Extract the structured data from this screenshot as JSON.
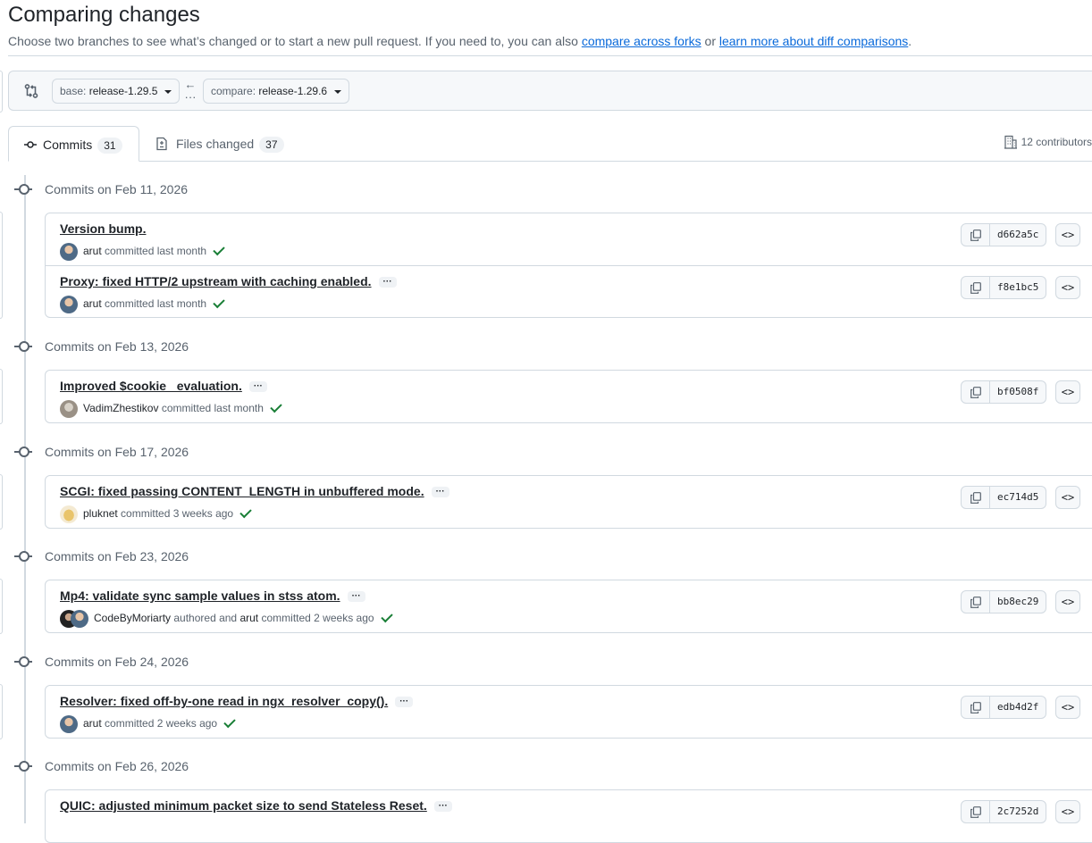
{
  "page": {
    "title": "Comparing changes",
    "subtitle_prefix": "Choose two branches to see what’s changed or to start a new pull request. If you need to, you can also ",
    "link_forks": "compare across forks",
    "subtitle_mid": " or ",
    "link_learn": "learn more about diff comparisons",
    "subtitle_suffix": "."
  },
  "range": {
    "base_key": "base:",
    "base_value": "release-1.29.5",
    "arrow_icon": "arrow-left-icon",
    "compare_key": "compare:",
    "compare_value": "release-1.29.6"
  },
  "tabs": [
    {
      "label": "Commits",
      "count": "31",
      "icon": "git-commit-icon"
    },
    {
      "label": "Files changed",
      "count": "37",
      "icon": "file-diff-icon"
    }
  ],
  "contributors": "12 contributors",
  "colors": {
    "link": "#0969da",
    "check": "#1a7f37",
    "border": "#d1d9e0",
    "muted": "#59636e"
  },
  "groups": [
    {
      "date": "Commits on Feb 11, 2026",
      "commits": [
        {
          "title": "Version bump.",
          "has_more": false,
          "author": "arut",
          "rest": "committed last month",
          "sha": "d662a5c"
        },
        {
          "title": "Proxy: fixed HTTP/2 upstream with caching enabled.",
          "has_more": true,
          "author": "arut",
          "rest": "committed last month",
          "sha": "f8e1bc5"
        }
      ]
    },
    {
      "date": "Commits on Feb 13, 2026",
      "commits": [
        {
          "title": "Improved $cookie_ evaluation.",
          "has_more": true,
          "author": "VadimZhestikov",
          "rest": "committed last month",
          "sha": "bf0508f"
        }
      ]
    },
    {
      "date": "Commits on Feb 17, 2026",
      "commits": [
        {
          "title": "SCGI: fixed passing CONTENT_LENGTH in unbuffered mode.",
          "has_more": true,
          "author": "pluknet",
          "rest": "committed 3 weeks ago",
          "sha": "ec714d5"
        }
      ]
    },
    {
      "date": "Commits on Feb 23, 2026",
      "commits": [
        {
          "title": "Mp4: validate sync sample values in stss atom.",
          "has_more": true,
          "author": "CodeByMoriarty",
          "rest": "authored and",
          "author2": "arut",
          "rest2": "committed 2 weeks ago",
          "sha": "bb8ec29"
        }
      ]
    },
    {
      "date": "Commits on Feb 24, 2026",
      "commits": [
        {
          "title": "Resolver: fixed off-by-one read in ngx_resolver_copy().",
          "has_more": true,
          "author": "arut",
          "rest": "committed 2 weeks ago",
          "sha": "edb4d2f"
        }
      ]
    },
    {
      "date": "Commits on Feb 26, 2026",
      "commits": [
        {
          "title": "QUIC: adjusted minimum packet size to send Stateless Reset.",
          "has_more": true,
          "author": "",
          "rest": "",
          "sha": "2c7252d"
        }
      ]
    }
  ]
}
